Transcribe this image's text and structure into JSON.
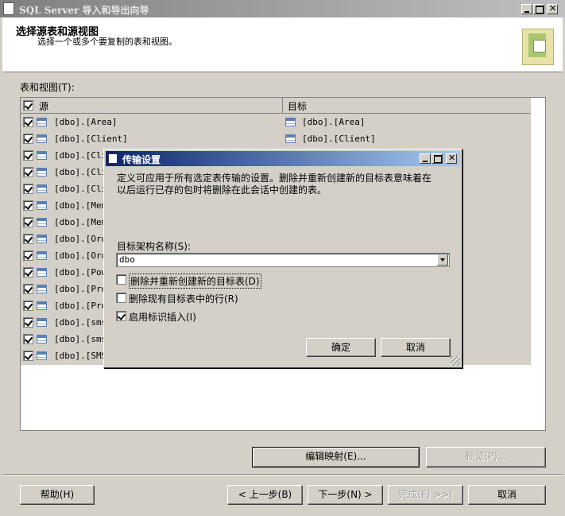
{
  "window": {
    "title": "SQL Server 导入和导出向导"
  },
  "header": {
    "title": "选择源表和源视图",
    "subtitle": "选择一个或多个要复制的表和视图。"
  },
  "main": {
    "tables_label": "表和视图(T):",
    "col_source": "源",
    "col_target": "目标",
    "rows": [
      {
        "source": "[dbo].[Area]",
        "target": "[dbo].[Area]",
        "checked": true
      },
      {
        "source": "[dbo].[Client]",
        "target": "[dbo].[Client]",
        "checked": true
      },
      {
        "source": "[dbo].[Cli",
        "target": "",
        "checked": true
      },
      {
        "source": "[dbo].[Cli",
        "target": "",
        "checked": true
      },
      {
        "source": "[dbo].[Cli",
        "target": "",
        "checked": true
      },
      {
        "source": "[dbo].[Mem",
        "target": "",
        "checked": true
      },
      {
        "source": "[dbo].[Mem",
        "target": "",
        "checked": true
      },
      {
        "source": "[dbo].[Ord",
        "target": "",
        "checked": true
      },
      {
        "source": "[dbo].[Ord",
        "target": "",
        "checked": true
      },
      {
        "source": "[dbo].[Pow",
        "target": "",
        "checked": true
      },
      {
        "source": "[dbo].[Pro",
        "target": "",
        "checked": true
      },
      {
        "source": "[dbo].[Pro",
        "target": "",
        "checked": true
      },
      {
        "source": "[dbo].[sms",
        "target": "",
        "checked": true
      },
      {
        "source": "[dbo].[sms",
        "target": "",
        "checked": true
      },
      {
        "source": "[dbo].[SMS",
        "target": "",
        "checked": true
      }
    ],
    "edit_mapping": "编辑映射(E)...",
    "preview": "预览(P)..."
  },
  "footer": {
    "help": "帮助(H)",
    "back": "< 上一步(B)",
    "next": "下一步(N) >",
    "finish": "完成(F) >>|",
    "cancel": "取消"
  },
  "dialog": {
    "title": "传输设置",
    "description": "定义可应用于所有选定表传输的设置。删除并重新创建新的目标表意味着在以后运行已存的包时将删除在此会话中创建的表。",
    "schema_label": "目标架构名称(S):",
    "schema_value": "dbo",
    "opt_recreate": "删除并重新创建新的目标表(D)",
    "opt_recreate_checked": false,
    "opt_delete_rows": "删除现有目标表中的行(R)",
    "opt_delete_rows_checked": false,
    "opt_identity": "启用标识插入(I)",
    "opt_identity_checked": true,
    "ok": "确定",
    "cancel": "取消"
  },
  "colors": {
    "titlebar_inactive": "#808080",
    "titlebar_active": "#0a246a",
    "face": "#d4d0c8"
  }
}
